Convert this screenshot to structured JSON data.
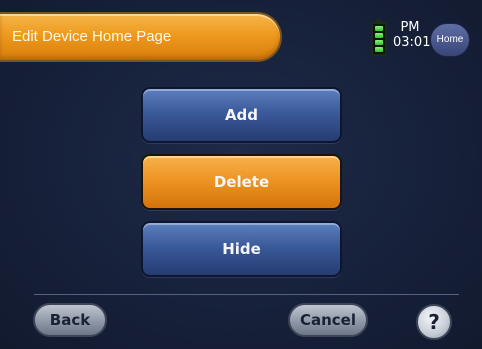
{
  "header": {
    "title": "Edit Device Home Page",
    "clock_period": "PM",
    "clock_time": "03:01",
    "home_label": "Home",
    "battery_icon": "battery-full-icon"
  },
  "actions": {
    "add_label": "Add",
    "delete_label": "Delete",
    "hide_label": "Hide",
    "selected": "Delete"
  },
  "footer": {
    "back_label": "Back",
    "cancel_label": "Cancel",
    "help_label": "?"
  },
  "colors": {
    "accent_orange": "#ee9524",
    "button_blue": "#3b5a9a",
    "background": "#162039"
  }
}
